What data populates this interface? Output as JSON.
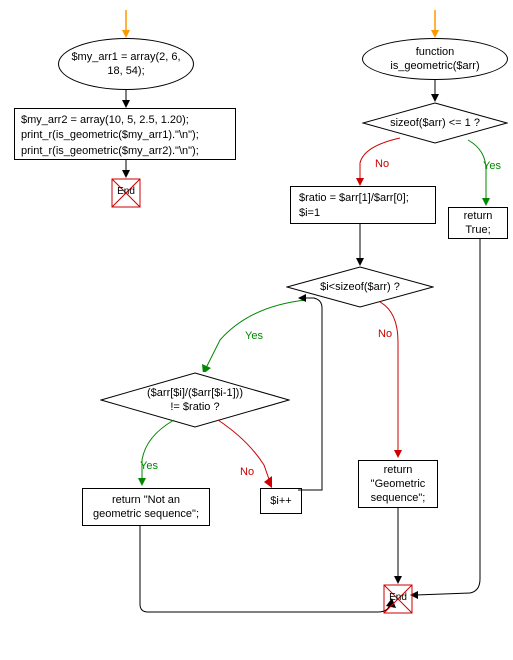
{
  "left": {
    "start": "$my_arr1 = array(2, 6, 18, 54);",
    "process": "$my_arr2 = array(10, 5, 2.5, 1.20);\nprint_r(is_geometric($my_arr1).\"\\n\");\nprint_r(is_geometric($my_arr2).\"\\n\");",
    "end": "End"
  },
  "right": {
    "func": "function is_geometric($arr)",
    "cond1": "sizeof($arr) <= 1 ?",
    "return_true": "return True;",
    "init": "$ratio = $arr[1]/$arr[0];\n$i=1",
    "cond2": "$i<sizeof($arr) ?",
    "cond3": "($arr[$i]/($arr[$i-1]))\n!= $ratio ?",
    "return_notgeo": "return \"Not an geometric sequence\";",
    "increment": "$i++",
    "return_geo": "return \"Geometric sequence\";",
    "end": "End"
  },
  "labels": {
    "yes": "Yes",
    "no": "No"
  },
  "colors": {
    "yes": "#008800",
    "no": "#cc0000",
    "entry_arrow": "#ff9900"
  }
}
